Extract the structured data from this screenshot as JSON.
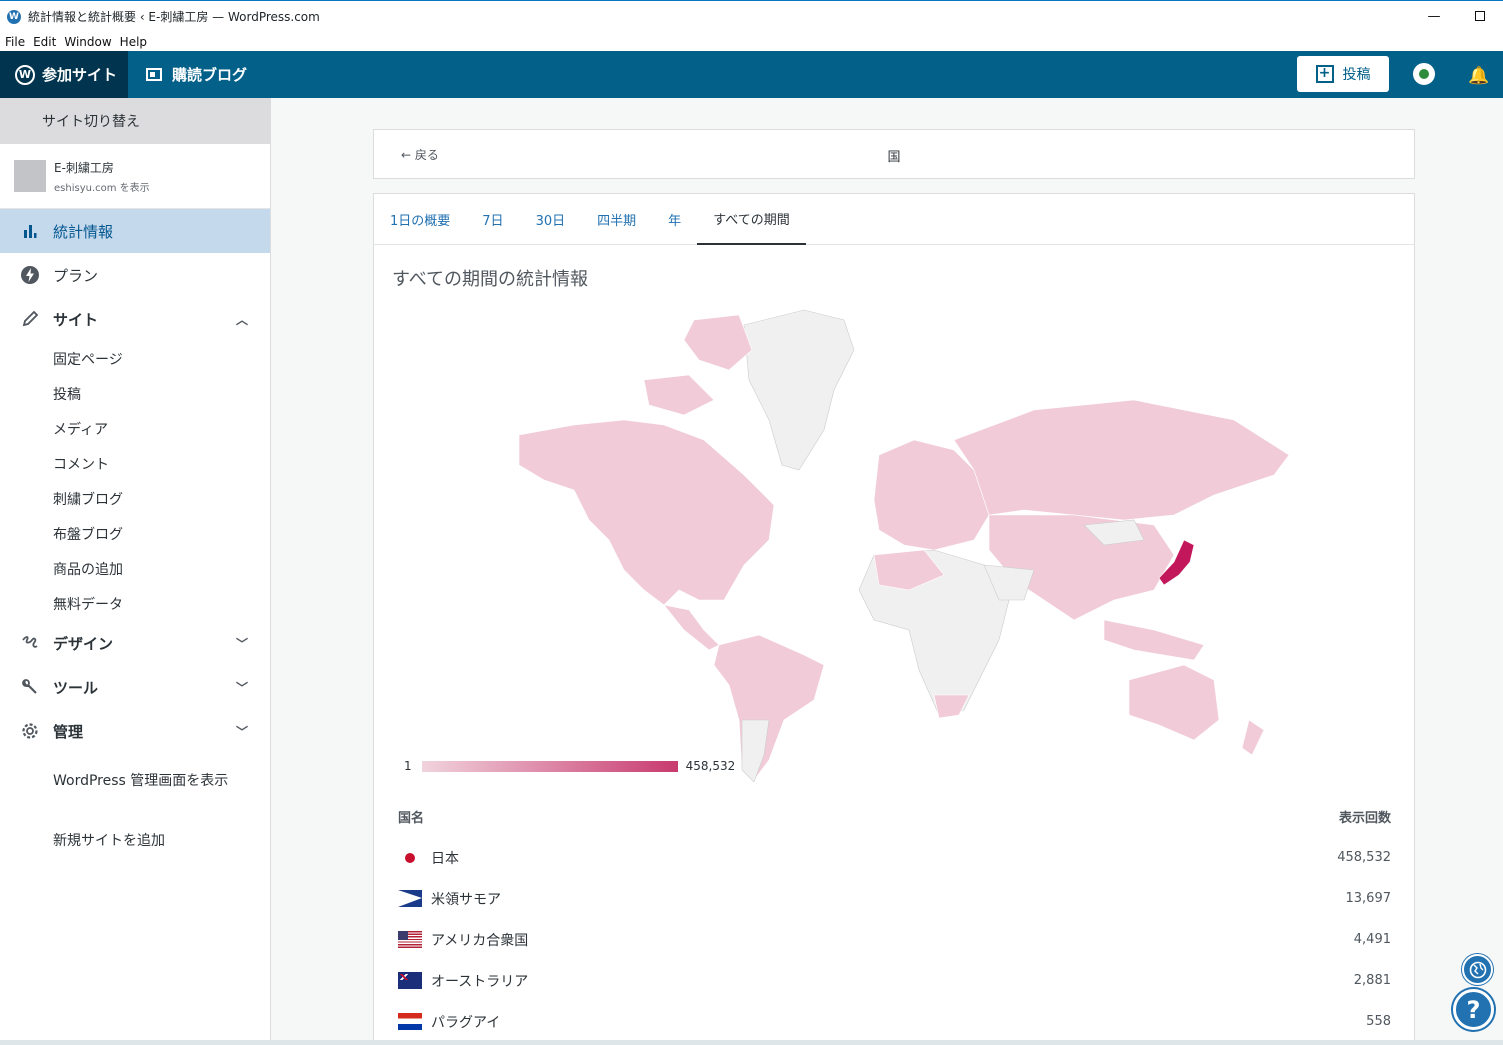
{
  "window": {
    "title": "統計情報と統計概要 ‹ E-刺繍工房 — WordPress.com",
    "logo_letter": "W",
    "minimize": "—",
    "menu": [
      "File",
      "Edit",
      "Window",
      "Help"
    ]
  },
  "masterbar": {
    "my_sites": "参加サイト",
    "reader": "購読ブログ",
    "write": "投稿"
  },
  "sidebar": {
    "switch_site": "サイト切り替え",
    "site_name": "E-刺繍工房",
    "site_url": "eshisyu.com を表示",
    "items": [
      {
        "label": "統計情報",
        "icon": "bar-chart-icon"
      },
      {
        "label": "プラン",
        "icon": "bolt-icon"
      },
      {
        "label": "サイト",
        "icon": "pencil-icon"
      },
      {
        "label": "デザイン",
        "icon": "brush-icon"
      },
      {
        "label": "ツール",
        "icon": "wrench-icon"
      },
      {
        "label": "管理",
        "icon": "gear-icon"
      }
    ],
    "site_sub": [
      "固定ページ",
      "投稿",
      "メディア",
      "コメント",
      "刺繍ブログ",
      "布盤ブログ",
      "商品の追加",
      "無料データ"
    ],
    "wp_admin": "WordPress 管理画面を表示",
    "add_site": "新規サイトを追加"
  },
  "header": {
    "back": "戻る",
    "title": "国"
  },
  "tabs": [
    "1日の概要",
    "7日",
    "30日",
    "四半期",
    "年",
    "すべての期間"
  ],
  "section_title": "すべての期間の統計情報",
  "map": {
    "legend_min": "1",
    "legend_max": "458,532",
    "color_low": "#f1d3dd",
    "color_high": "#c83a6e",
    "color_none": "#f0f0f0"
  },
  "table": {
    "col_country": "国名",
    "col_views": "表示回数",
    "rows": [
      {
        "name": "日本",
        "views": "458,532",
        "flag": "flag-jp"
      },
      {
        "name": "米領サモア",
        "views": "13,697",
        "flag": "flag-as"
      },
      {
        "name": "アメリカ合衆国",
        "views": "4,491",
        "flag": "flag-us"
      },
      {
        "name": "オーストラリア",
        "views": "2,881",
        "flag": "flag-au"
      },
      {
        "name": "パラグアイ",
        "views": "558",
        "flag": "flag-py"
      }
    ]
  },
  "help": "?"
}
